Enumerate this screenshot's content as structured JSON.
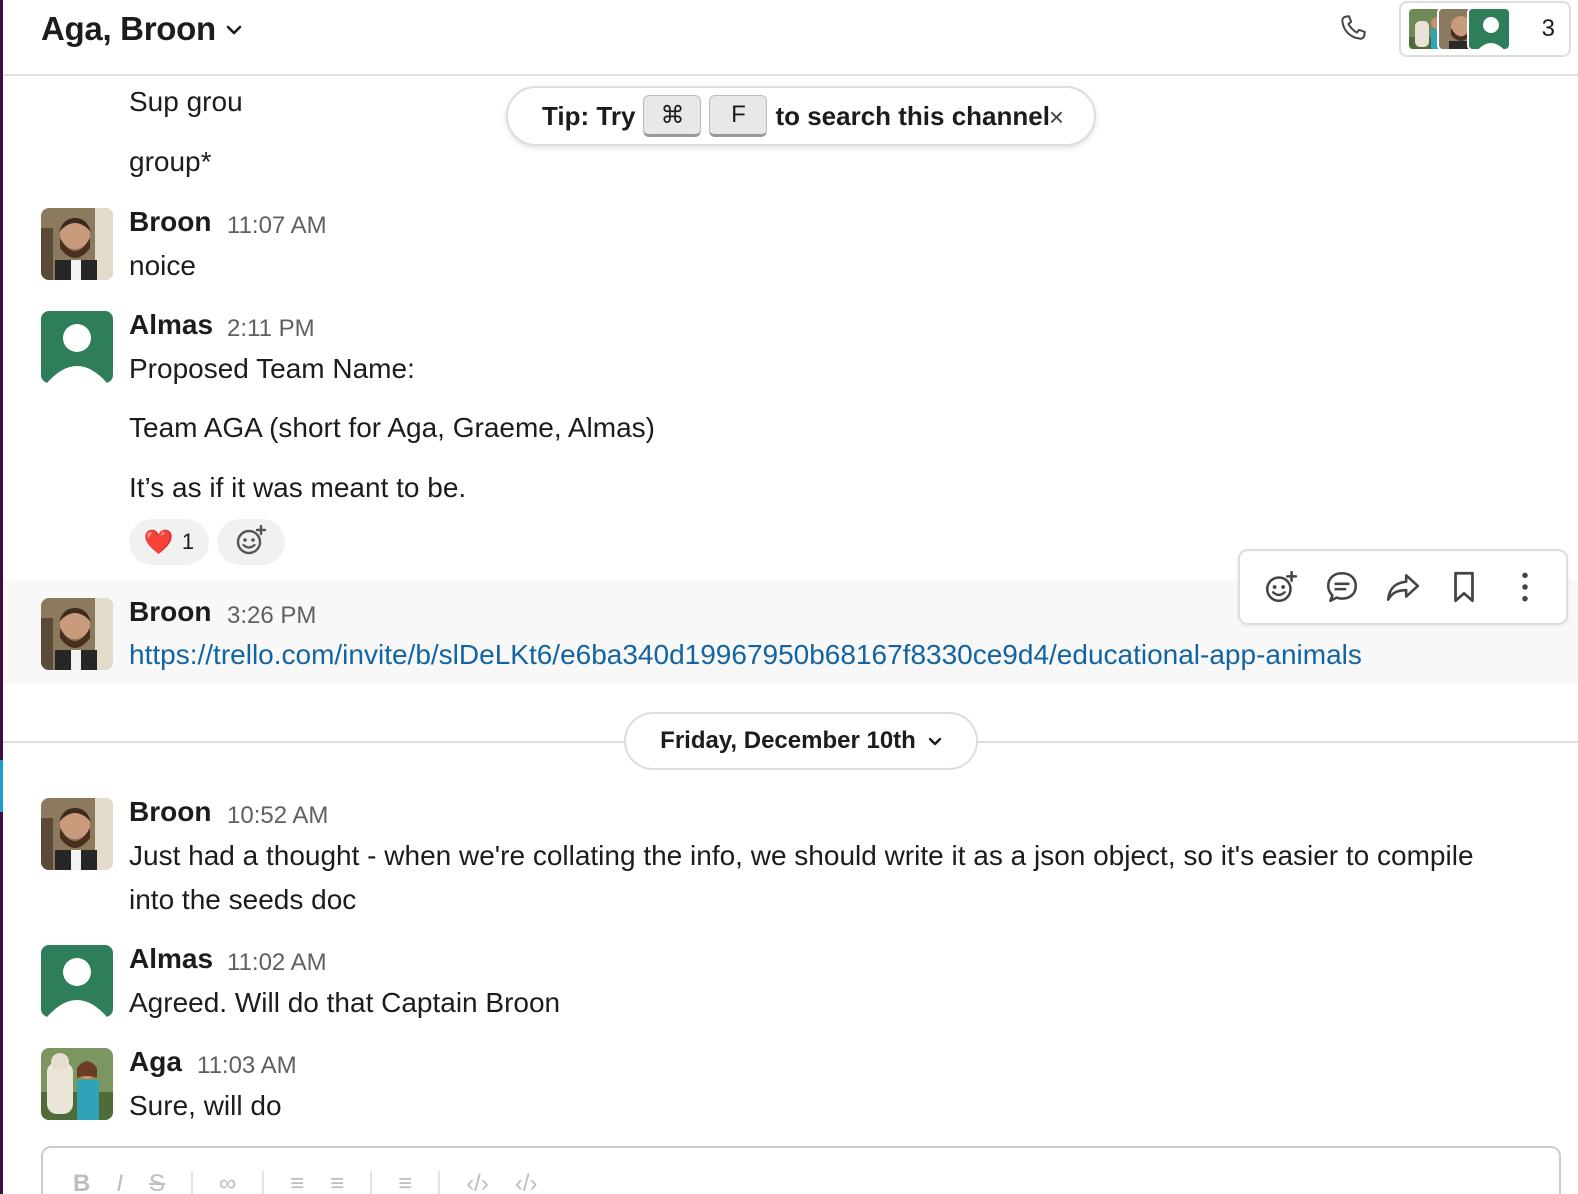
{
  "header": {
    "title": "Aga, Broon",
    "member_count": "3"
  },
  "tip": {
    "prefix": "Tip: Try",
    "key1": "⌘",
    "key2": "F",
    "suffix": "to search this channel",
    "close": "×"
  },
  "messages": {
    "cont1": "Sup grou",
    "cont2": "group*",
    "m1": {
      "name": "Broon",
      "time": "11:07 AM",
      "text": "noice"
    },
    "m2": {
      "name": "Almas",
      "time": "2:11 PM",
      "line1": "Proposed Team Name:",
      "line2": "Team AGA (short for Aga, Graeme, Almas)",
      "line3": "It’s as if it was meant to be.",
      "reaction_emoji": "❤️",
      "reaction_count": "1"
    },
    "m3": {
      "name": "Broon",
      "time": "3:26 PM",
      "link": "https://trello.com/invite/b/slDeLKt6/e6ba340d19967950b68167f8330ce9d4/educational-app-animals"
    },
    "m4": {
      "name": "Broon",
      "time": "10:52 AM",
      "line1": "Just had a thought - when we're collating the info, we should write it as a json object, so it's easier to compile",
      "line2": "into the seeds doc"
    },
    "m5": {
      "name": "Almas",
      "time": "11:02 AM",
      "text": "Agreed. Will do that Captain Broon"
    },
    "m6": {
      "name": "Aga",
      "time": "11:03 AM",
      "text": "Sure, will do"
    }
  },
  "date_divider": "Friday, December 10th",
  "colors": {
    "link": "#1264a3",
    "rail": "#3f0e40",
    "almas_avatar": "#2e7d5b"
  },
  "icons": {
    "phone": "phone-icon",
    "chevron": "chevron-down-icon",
    "add_reaction": "add-reaction-icon",
    "reply_thread": "reply-thread-icon",
    "share": "share-icon",
    "bookmark": "bookmark-icon",
    "more": "more-actions-icon"
  }
}
